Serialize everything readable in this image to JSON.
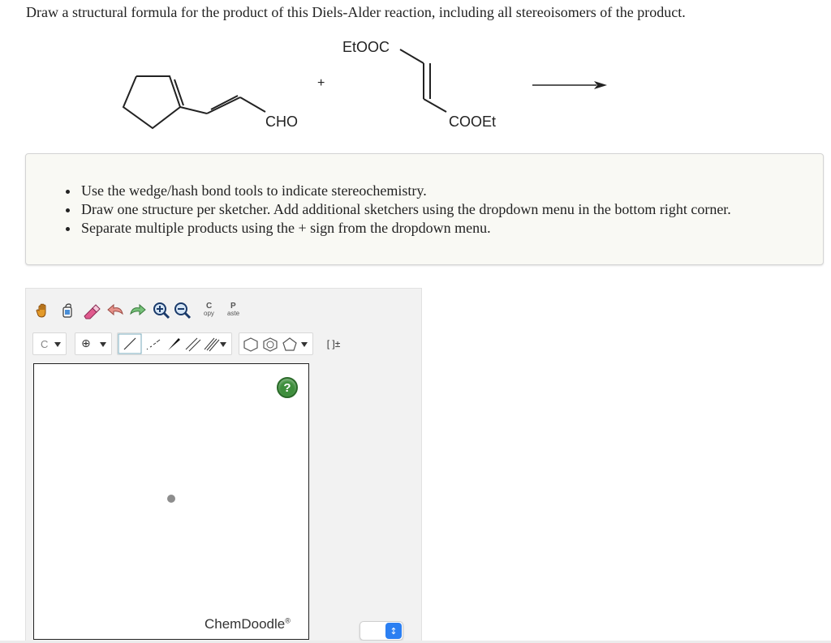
{
  "question": "Draw a structural formula for the product of this Diels-Alder reaction, including all stereoisomers of the product.",
  "reaction": {
    "reactant1_label": "CHO",
    "plus_sign": "+",
    "reactant2_top_label": "EtOOC",
    "reactant2_bottom_label": "COOEt"
  },
  "instructions": [
    "Use the wedge/hash bond tools to indicate stereochemistry.",
    "Draw one structure per sketcher. Add additional sketchers using the dropdown menu in the bottom right corner.",
    "Separate multiple products using the + sign from the dropdown menu."
  ],
  "sketcher": {
    "toolbar1": {
      "copy_top": "C",
      "copy_bottom": "opy",
      "paste_top": "P",
      "paste_bottom": "aste"
    },
    "toolbar2": {
      "atom_select": "C",
      "charge_symbol": "⊕",
      "bracket_label": "[ ]±"
    },
    "help_label": "?",
    "brand": "ChemDoodle",
    "brand_mark": "®"
  },
  "icons": {
    "hand": "hand-icon",
    "lasso": "lasso-icon",
    "eraser": "eraser-icon",
    "undo": "undo-icon",
    "redo": "redo-icon",
    "zoom_in": "zoom-in-icon",
    "zoom_out": "zoom-out-icon"
  },
  "colors": {
    "help_green": "#3e8e3c",
    "stepper_blue": "#2b7ff2",
    "instruction_bg": "#f9f9f4"
  }
}
